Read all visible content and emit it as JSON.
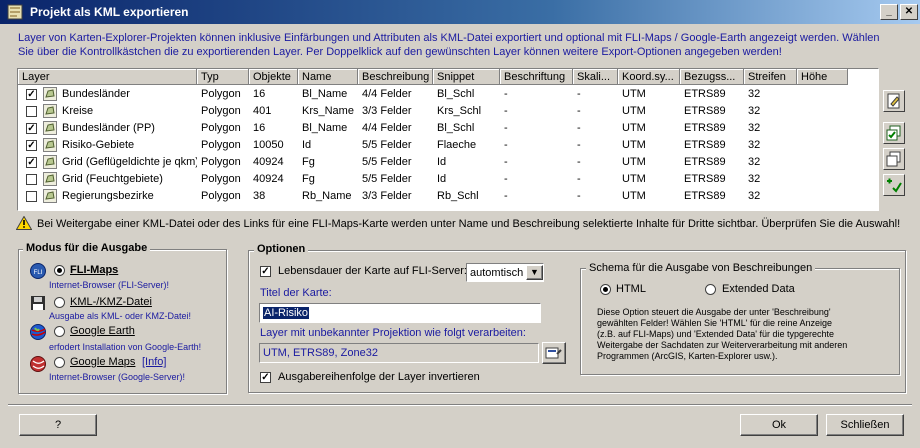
{
  "window": {
    "title": "Projekt als KML exportieren",
    "min": "_",
    "close": "✕"
  },
  "intro": "Layer von Karten-Explorer-Projekten können inklusive Einfärbungen und Attributen als KML-Datei exportiert und optional mit FLI-Maps / Google-Earth angezeigt werden. Wählen Sie über die Kontrollkästchen die zu exportierenden Layer. Per Doppelklick auf den gewünschten Layer können weitere Export-Optionen angegeben werden!",
  "columns": [
    "Layer",
    "Typ",
    "Objekte",
    "Name",
    "Beschreibung",
    "Snippet",
    "Beschriftung",
    "Skali...",
    "Koord.sy...",
    "Bezugss...",
    "Streifen",
    "Höhe"
  ],
  "layers": [
    {
      "checked": true,
      "cells": [
        "Bundesländer",
        "Polygon",
        "16",
        "Bl_Name",
        "4/4 Felder",
        "Bl_Schl",
        "-",
        "-",
        "UTM",
        "ETRS89",
        "32",
        ""
      ]
    },
    {
      "checked": false,
      "cells": [
        "Kreise",
        "Polygon",
        "401",
        "Krs_Name",
        "3/3 Felder",
        "Krs_Schl",
        "-",
        "-",
        "UTM",
        "ETRS89",
        "32",
        ""
      ]
    },
    {
      "checked": true,
      "cells": [
        "Bundesländer (PP)",
        "Polygon",
        "16",
        "Bl_Name",
        "4/4 Felder",
        "Bl_Schl",
        "-",
        "-",
        "UTM",
        "ETRS89",
        "32",
        ""
      ]
    },
    {
      "checked": true,
      "cells": [
        "Risiko-Gebiete",
        "Polygon",
        "10050",
        "Id",
        "5/5 Felder",
        "Flaeche",
        "-",
        "-",
        "UTM",
        "ETRS89",
        "32",
        ""
      ]
    },
    {
      "checked": true,
      "cells": [
        "Grid (Geflügeldichte je qkm)",
        "Polygon",
        "40924",
        "Fg",
        "5/5 Felder",
        "Id",
        "-",
        "-",
        "UTM",
        "ETRS89",
        "32",
        ""
      ]
    },
    {
      "checked": false,
      "cells": [
        "Grid (Feuchtgebiete)",
        "Polygon",
        "40924",
        "Fg",
        "5/5 Felder",
        "Id",
        "-",
        "-",
        "UTM",
        "ETRS89",
        "32",
        ""
      ]
    },
    {
      "checked": false,
      "cells": [
        "Regierungsbezirke",
        "Polygon",
        "38",
        "Rb_Name",
        "3/3 Felder",
        "Rb_Schl",
        "-",
        "-",
        "UTM",
        "ETRS89",
        "32",
        ""
      ]
    }
  ],
  "warning": "Bei Weitergabe einer KML-Datei oder des Links für eine FLI-Maps-Karte werden unter Name und Beschreibung selektierte Inhalte für Dritte sichtbar. Überprüfen Sie die Auswahl!",
  "mode": {
    "title": "Modus für die Ausgabe",
    "fli_label": "FLI-Maps",
    "fli_sub": "Internet-Browser (FLI-Server)!",
    "kml_label": "KML-/KMZ-Datei",
    "kml_sub": "Ausgabe als KML- oder KMZ-Datei!",
    "ge_label": "Google Earth",
    "ge_sub": "erfodert Installation von Google-Earth!",
    "gm_label": "Google Maps",
    "gm_info": "[Info]",
    "gm_sub": "Internet-Browser (Google-Server)!",
    "fli_icon_text": "FLI"
  },
  "options": {
    "title": "Optionen",
    "lifetime_label": "Lebensdauer der Karte auf FLI-Server:",
    "lifetime_value": "automtisch",
    "map_title_label": "Titel der Karte:",
    "map_title_value": "AI-Risiko",
    "projection_label": "Layer mit unbekannter Projektion wie folgt verarbeiten:",
    "projection_value": "UTM, ETRS89, Zone32",
    "invert_label": "Ausgabereihenfolge der Layer invertieren"
  },
  "schema": {
    "title": "Schema für die Ausgabe von Beschreibungen",
    "html_label": "HTML",
    "ext_label": "Extended Data",
    "desc_lines": [
      "Diese Option steuert die Ausgabe der unter 'Beschreibung'",
      "gewählten Felder! Wählen Sie 'HTML' für die reine Anzeige",
      "(z.B. auf FLI-Maps) und 'Extended Data' für die typgerechte",
      "Weitergabe der Sachdaten zur Weiterverarbeitung mit anderen",
      "Programmen (ArcGIS, Karten-Explorer usw.)."
    ]
  },
  "buttons": {
    "help": "?",
    "ok": "Ok",
    "close": "Schließen"
  },
  "colors": {
    "face": "#d4d0c8",
    "title_start": "#0a246a",
    "title_end": "#a6caf0",
    "info_text": "#1a1aa0",
    "selection": "#0a246a"
  }
}
